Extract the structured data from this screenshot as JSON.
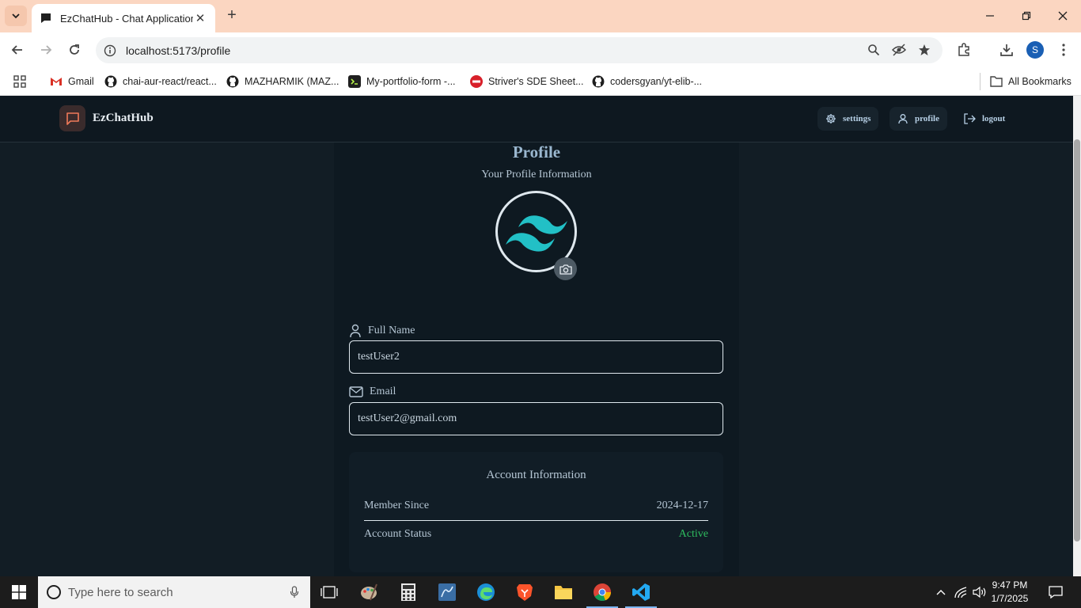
{
  "browser": {
    "tab_title": "EzChatHub - Chat Application",
    "tab_close": "✕",
    "new_tab": "+",
    "url": "localhost:5173/profile",
    "profile_initial": "S"
  },
  "bookmarks": {
    "items": [
      {
        "label": "Gmail"
      },
      {
        "label": "chai-aur-react/react..."
      },
      {
        "label": "MAZHARMIK (MAZ..."
      },
      {
        "label": "My-portfolio-form -..."
      },
      {
        "label": "Striver's SDE Sheet..."
      },
      {
        "label": "codersgyan/yt-elib-..."
      }
    ],
    "all_bookmarks": "All Bookmarks"
  },
  "app": {
    "brand": "EzChatHub",
    "nav": {
      "settings": "settings",
      "profile": "profile",
      "logout": "logout"
    },
    "profile": {
      "title": "Profile",
      "subtitle": "Your Profile Information",
      "full_name_label": "Full Name",
      "full_name_value": "testUser2",
      "email_label": "Email",
      "email_value": "testUser2@gmail.com"
    },
    "account": {
      "title": "Account Information",
      "member_since_label": "Member Since",
      "member_since_value": "2024-12-17",
      "status_label": "Account Status",
      "status_value": "Active"
    },
    "colors": {
      "accent": "#9ab7cf",
      "active": "#2fbf5f",
      "background": "#121d25",
      "tab_bar": "#fbd6c1"
    }
  },
  "taskbar": {
    "search_placeholder": "Type here to search",
    "time": "9:47 PM",
    "date": "1/7/2025"
  }
}
